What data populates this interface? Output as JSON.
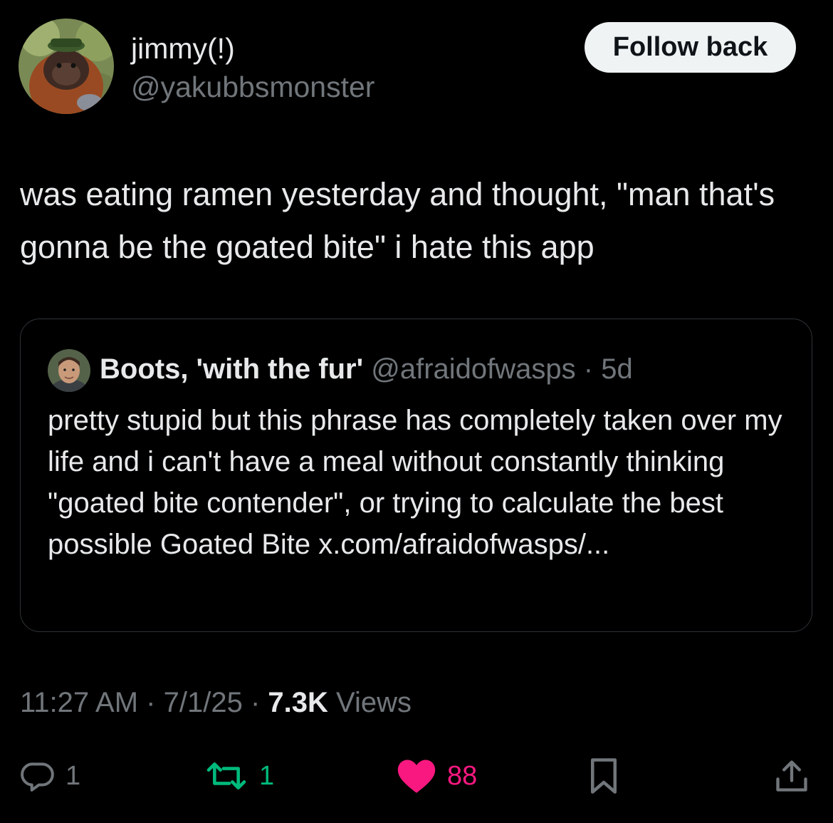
{
  "author": {
    "display_name": "jimmy(!)",
    "handle": "@yakubbsmonster",
    "avatar_icon": "orangutan-avatar"
  },
  "follow_button": {
    "label": "Follow back"
  },
  "tweet": {
    "text": "was eating ramen yesterday and thought, \"man that's gonna be the goated bite\" i hate this app"
  },
  "quoted_tweet": {
    "display_name": "Boots, 'with the fur'",
    "handle": "@afraidofwasps",
    "separator": "·",
    "age": "5d",
    "text": "pretty stupid but this phrase has completely taken over my life and i can't have a meal without constantly thinking \"goated bite contender\", or trying to calculate the best possible Goated Bite x.com/afraidofwasps/...",
    "avatar_icon": "profile-photo-avatar"
  },
  "meta": {
    "time": "11:27 AM",
    "separator": "·",
    "date": "7/1/25",
    "views_count": "7.3K",
    "views_label": "Views"
  },
  "actions": {
    "reply": {
      "count": "1",
      "icon": "reply-bubble-icon"
    },
    "retweet": {
      "count": "1",
      "icon": "retweet-icon",
      "color": "#00ba7c"
    },
    "like": {
      "count": "88",
      "icon": "heart-filled-icon",
      "color": "#f91880"
    },
    "bookmark": {
      "icon": "bookmark-icon"
    },
    "share": {
      "icon": "share-icon"
    }
  },
  "colors": {
    "background": "#000000",
    "text": "#e7e9ea",
    "muted": "#71767b",
    "border": "#2f3336"
  }
}
